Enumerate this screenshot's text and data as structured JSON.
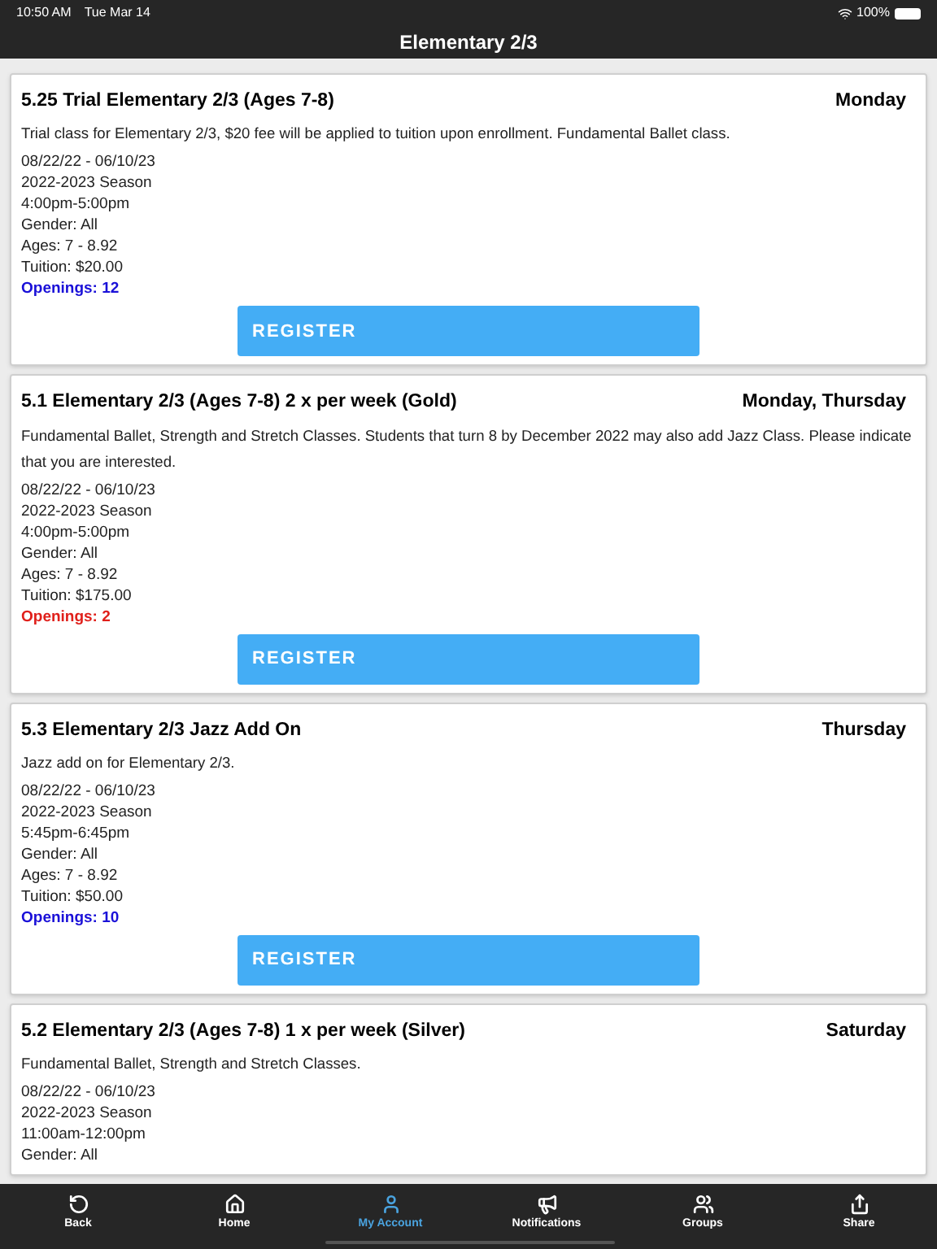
{
  "status_bar": {
    "time": "10:50 AM",
    "date": "Tue Mar 14",
    "battery": "100%"
  },
  "header": {
    "title": "Elementary 2/3"
  },
  "classes": [
    {
      "title": "5.25 Trial Elementary 2/3 (Ages 7-8)",
      "days": "Monday",
      "description": "Trial class for Elementary 2/3, $20 fee will be applied to tuition upon enrollment. Fundamental Ballet class.",
      "details": [
        "08/22/22 - 06/10/23",
        "2022-2023 Season",
        "4:00pm-5:00pm",
        "Gender: All",
        "Ages: 7 - 8.92",
        "Tuition: $20.00"
      ],
      "openings": {
        "text": "Openings: 12",
        "color": "#1a10d8"
      },
      "button": "REGISTER"
    },
    {
      "title": "5.1 Elementary 2/3 (Ages 7-8) 2 x per week (Gold)",
      "days": "Monday, Thursday",
      "description": "Fundamental Ballet, Strength and Stretch Classes. Students that turn 8 by December 2022 may also add Jazz Class. Please indicate that you are interested.",
      "details": [
        "08/22/22 - 06/10/23",
        "2022-2023 Season",
        "4:00pm-5:00pm",
        "Gender: All",
        "Ages: 7 - 8.92",
        "Tuition: $175.00"
      ],
      "openings": {
        "text": "Openings: 2",
        "color": "#e0201b"
      },
      "button": "REGISTER"
    },
    {
      "title": "5.3 Elementary 2/3 Jazz Add On",
      "days": "Thursday",
      "description": "Jazz add on for Elementary 2/3.",
      "details": [
        "08/22/22 - 06/10/23",
        "2022-2023 Season",
        "5:45pm-6:45pm",
        "Gender: All",
        "Ages: 7 - 8.92",
        "Tuition: $50.00"
      ],
      "openings": {
        "text": "Openings: 10",
        "color": "#1a10d8"
      },
      "button": "REGISTER"
    },
    {
      "title": "5.2 Elementary 2/3 (Ages 7-8) 1 x per week (Silver)",
      "days": "Saturday",
      "description": "Fundamental Ballet, Strength and Stretch Classes.",
      "details": [
        "08/22/22 - 06/10/23",
        "2022-2023 Season",
        "11:00am-12:00pm",
        "Gender: All"
      ]
    }
  ],
  "tab_bar": [
    {
      "kind": "back",
      "label": "Back",
      "selected": false
    },
    {
      "kind": "home",
      "label": "Home",
      "selected": false
    },
    {
      "kind": "account",
      "label": "My Account",
      "selected": true
    },
    {
      "kind": "notifications",
      "label": "Notifications",
      "selected": false
    },
    {
      "kind": "groups",
      "label": "Groups",
      "selected": false
    },
    {
      "kind": "share",
      "label": "Share",
      "selected": false
    }
  ]
}
